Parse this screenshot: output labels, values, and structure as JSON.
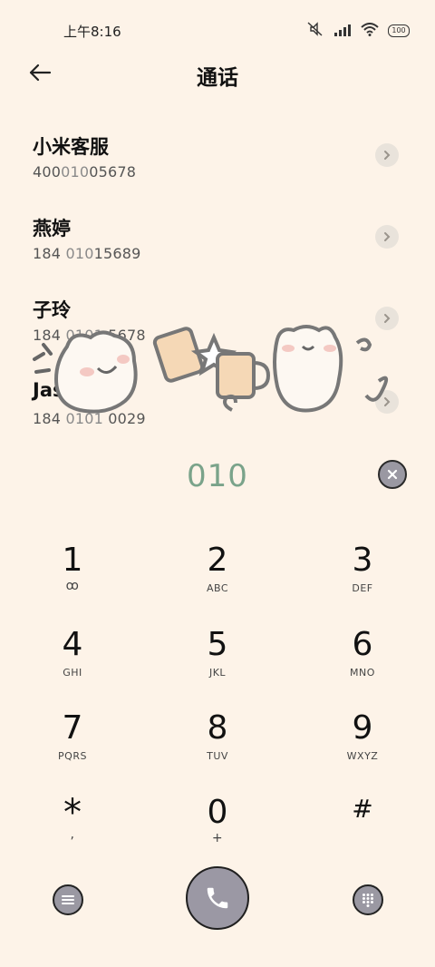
{
  "status_bar": {
    "time": "上午8:16",
    "battery": "100",
    "icons": [
      "mute-icon",
      "signal-icon",
      "wifi-icon",
      "battery-icon"
    ]
  },
  "header": {
    "title": "通话",
    "back_icon": "back-arrow-icon"
  },
  "contacts": [
    {
      "name": "小米客服",
      "number_pre": "400",
      "number_match": "010",
      "number_post": "05678"
    },
    {
      "name": "燕婷",
      "number_pre": "184 ",
      "number_match": "010",
      "number_post": "15689"
    },
    {
      "name": "子玲",
      "number_pre": "184 ",
      "number_match": "0101",
      "number_post": " 5678"
    },
    {
      "name": "Jason",
      "number_pre": "184 ",
      "number_match": "0101",
      "number_post": " 0029"
    }
  ],
  "dialer": {
    "input": "010",
    "keys": [
      {
        "digit": "1",
        "letters": "ꝏ"
      },
      {
        "digit": "2",
        "letters": "ABC"
      },
      {
        "digit": "3",
        "letters": "DEF"
      },
      {
        "digit": "4",
        "letters": "GHI"
      },
      {
        "digit": "5",
        "letters": "JKL"
      },
      {
        "digit": "6",
        "letters": "MNO"
      },
      {
        "digit": "7",
        "letters": "PQRS"
      },
      {
        "digit": "8",
        "letters": "TUV"
      },
      {
        "digit": "9",
        "letters": "WXYZ"
      },
      {
        "digit": "*",
        "letters": ","
      },
      {
        "digit": "0",
        "letters": "+"
      },
      {
        "digit": "#",
        "letters": ""
      }
    ]
  },
  "colors": {
    "background": "#fdf3e8",
    "input_accent": "#7aa38a",
    "button_fill": "#9a98a2"
  }
}
